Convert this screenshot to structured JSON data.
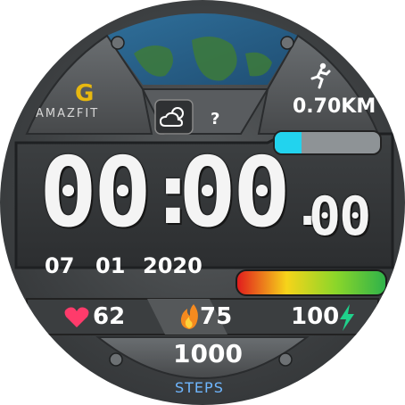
{
  "brand": {
    "name": "AMAZFIT",
    "logo_letter": "G"
  },
  "weather": {
    "icon": "partly-cloudy-icon",
    "temperature": "?"
  },
  "distance": {
    "icon": "running-man-icon",
    "value": "0.70KM"
  },
  "battery_bar": {
    "fraction": 0.25,
    "fill_color": "#22d3ee",
    "track_color": "#8e9396"
  },
  "time": {
    "hours": "00",
    "separator": ":",
    "minutes": "00",
    "seconds_sep": ".",
    "seconds": "00"
  },
  "date": {
    "day": "07",
    "month": "01",
    "year": "2020"
  },
  "gradient_bar": {
    "colors": [
      "#e11d1d",
      "#f6d41a",
      "#8bd62a",
      "#2fb24a"
    ]
  },
  "stats": {
    "heart": {
      "icon": "heart-icon",
      "value": "62",
      "color": "#ff3b6b"
    },
    "calories": {
      "icon": "flame-icon",
      "value": "75",
      "color": "#f58a1f"
    },
    "battery": {
      "icon": "lightning-icon",
      "value": "100",
      "color": "#1fd18b"
    }
  },
  "steps": {
    "value": "1000",
    "label": "STEPS",
    "label_color": "#6fb7ff"
  }
}
